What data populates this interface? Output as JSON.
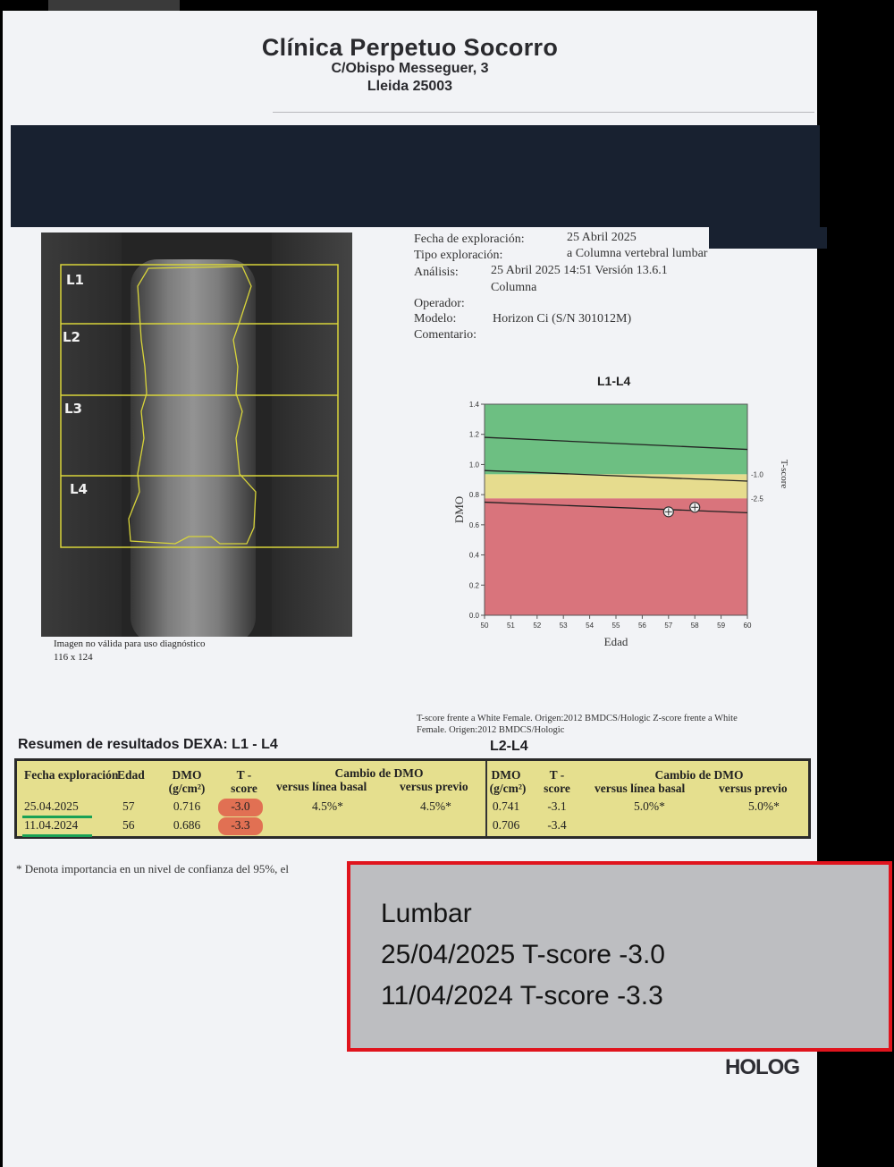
{
  "header": {
    "clinic_name": "Clínica Perpetuo Socorro",
    "address_line1": "C/Obispo Messeguer, 3",
    "address_line2": "Lleida 25003"
  },
  "scan": {
    "vertebra_labels": [
      "L1",
      "L2",
      "L3",
      "L4"
    ],
    "note": "Imagen no válida para uso diagnóstico",
    "dimensions": "116 x 124"
  },
  "exam_info": {
    "fecha_label": "Fecha de exploración:",
    "fecha_value": "25 Abril 2025",
    "tipo_label": "Tipo exploración:",
    "tipo_value": "a Columna vertebral lumbar",
    "analisis_label": "Análisis:",
    "analisis_value": "25 Abril 2025 14:51 Versión 13.6.1",
    "analisis_value2": "Columna",
    "operador_label": "Operador:",
    "modelo_label": "Modelo:",
    "modelo_value": "Horizon Ci (S/N 301012M)",
    "comentario_label": "Comentario:"
  },
  "chart_data": {
    "type": "scatter",
    "title": "L1-L4",
    "xlabel": "Edad",
    "ylabel": "DMO",
    "y2label": "T-score",
    "xlim": [
      50,
      60
    ],
    "ylim": [
      0.0,
      1.4
    ],
    "x_ticks": [
      "50",
      "51",
      "52",
      "53",
      "54",
      "55",
      "56",
      "57",
      "58",
      "59",
      "60"
    ],
    "y_ticks": [
      "0.0",
      "0.2",
      "0.4",
      "0.6",
      "0.8",
      "1.0",
      "1.2",
      "1.4"
    ],
    "t_score_ticks": [
      "-1.0",
      "-2.5"
    ],
    "bands": [
      {
        "name": "normal",
        "from": 0.935,
        "to": 1.4,
        "color": "#6dbf82"
      },
      {
        "name": "osteopenia",
        "from": 0.775,
        "to": 0.935,
        "color": "#e6dc8e"
      },
      {
        "name": "osteoporosis",
        "from": 0.0,
        "to": 0.775,
        "color": "#d9747c"
      }
    ],
    "reference_lines": [
      {
        "x": [
          50,
          60
        ],
        "y": [
          1.18,
          1.1
        ]
      },
      {
        "x": [
          50,
          60
        ],
        "y": [
          0.96,
          0.89
        ]
      },
      {
        "x": [
          50,
          60
        ],
        "y": [
          0.75,
          0.68
        ]
      }
    ],
    "points": [
      {
        "x": 57,
        "y": 0.686
      },
      {
        "x": 58,
        "y": 0.716
      }
    ]
  },
  "footnote": {
    "line1": "T-score frente a White Female. Origen:2012 BMDCS/Hologic Z-score frente a White",
    "line2": "Female. Origen:2012 BMDCS/Hologic"
  },
  "summary": {
    "title": "Resumen de resultados DEXA: L1 - L4",
    "title2": "L2-L4",
    "headers": {
      "fecha": "Fecha exploración",
      "edad": "Edad",
      "dmo": "DMO",
      "dmo_unit": "(g/cm²)",
      "tscore1": "T -",
      "tscore2": "score",
      "cambio": "Cambio de DMO",
      "basal": "versus línea basal",
      "previo": "versus previo"
    },
    "rows": [
      {
        "fecha": "25.04.2025",
        "edad": "57",
        "dmo": "0.716",
        "tscore": "-3.0",
        "basal": "4.5%*",
        "previo": "4.5%*",
        "dmo2": "0.741",
        "tscore2": "-3.1",
        "basal2": "5.0%*",
        "previo2": "5.0%*"
      },
      {
        "fecha": "11.04.2024",
        "edad": "56",
        "dmo": "0.686",
        "tscore": "-3.3",
        "basal": "",
        "previo": "",
        "dmo2": "0.706",
        "tscore2": "-3.4",
        "basal2": "",
        "previo2": ""
      }
    ]
  },
  "asterisk_note": "* Denota importancia en un nivel de confianza del 95%, el",
  "callout": {
    "line1": "Lumbar",
    "line2": "25/04/2025 T-score -3.0",
    "line3": "11/04/2024 T-score -3.3"
  },
  "brand": "HOLOG"
}
